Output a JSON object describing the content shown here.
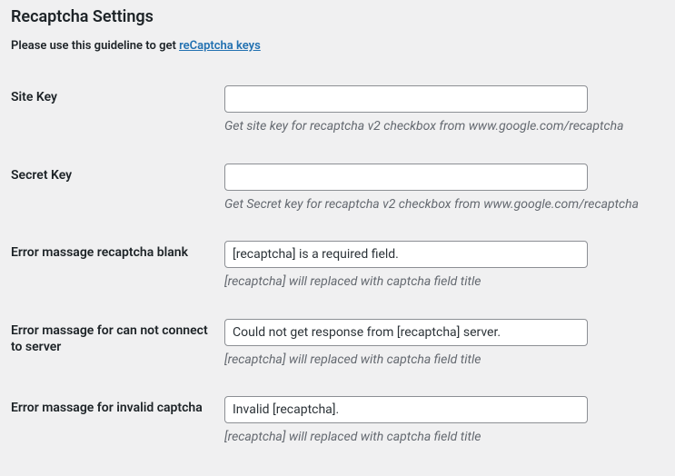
{
  "title": "Recaptcha Settings",
  "guideline": {
    "prefix": "Please use this guideline to get ",
    "link_text": "reCaptcha keys"
  },
  "fields": {
    "site_key": {
      "label": "Site Key",
      "value": "",
      "description": "Get site key for recaptcha v2 checkbox from www.google.com/recaptcha"
    },
    "secret_key": {
      "label": "Secret Key",
      "value": "",
      "description": "Get Secret key for recaptcha v2 checkbox from www.google.com/recaptcha"
    },
    "error_blank": {
      "label": "Error massage recaptcha blank",
      "value": "[recaptcha] is a required field.",
      "description": "[recaptcha] will replaced with captcha field title"
    },
    "error_connection": {
      "label": "Error massage for can not connect to server",
      "value": "Could not get response from [recaptcha] server.",
      "description": "[recaptcha] will replaced with captcha field title"
    },
    "error_invalid": {
      "label": "Error massage for invalid captcha",
      "value": "Invalid [recaptcha].",
      "description": "[recaptcha] will replaced with captcha field title"
    }
  }
}
